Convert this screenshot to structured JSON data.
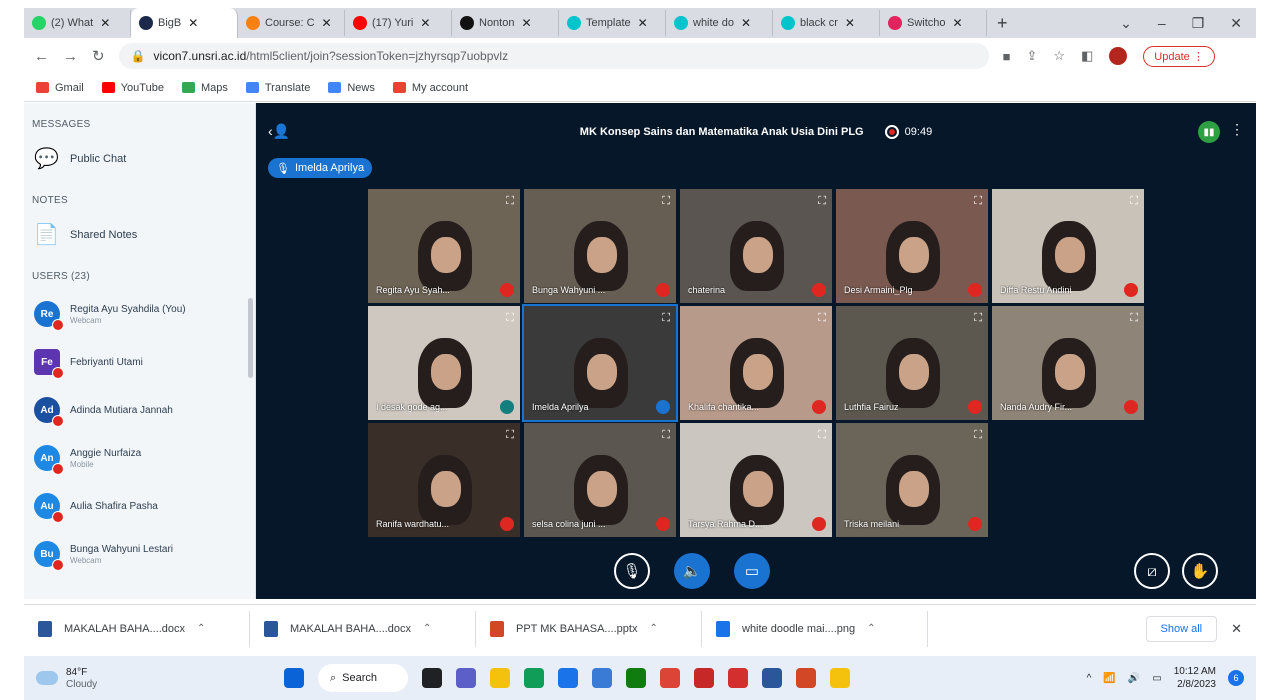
{
  "browser": {
    "tabs": [
      {
        "title": "(2) What",
        "icon": "whatsapp-icon",
        "color": "#25d366",
        "active": false
      },
      {
        "title": "BigB",
        "icon": "bigbluebutton-icon",
        "color": "#1b2a4a",
        "active": true
      },
      {
        "title": "Course: C",
        "icon": "moodle-icon",
        "color": "#f98012",
        "active": false
      },
      {
        "title": "(17) Yuri",
        "icon": "youtube-icon",
        "color": "#ff0000",
        "active": false
      },
      {
        "title": "Nonton",
        "icon": "video-icon",
        "color": "#111111",
        "active": false
      },
      {
        "title": "Template",
        "icon": "canva-icon",
        "color": "#00c4cc",
        "active": false
      },
      {
        "title": "white do",
        "icon": "canva-icon",
        "color": "#00c4cc",
        "active": false
      },
      {
        "title": "black cr",
        "icon": "canva-icon",
        "color": "#00c4cc",
        "active": false
      },
      {
        "title": "Switcho",
        "icon": "app-icon",
        "color": "#e0245e",
        "active": false
      }
    ],
    "url_host": "vicon7.unsri.ac.id",
    "url_path": "/html5client/join?sessionToken=jzhyrsqp7uobpvlz",
    "update_label": "Update",
    "bookmarks": [
      {
        "label": "Gmail",
        "color": "#ea4335"
      },
      {
        "label": "YouTube",
        "color": "#ff0000"
      },
      {
        "label": "Maps",
        "color": "#34a853"
      },
      {
        "label": "Translate",
        "color": "#4285f4"
      },
      {
        "label": "News",
        "color": "#4285f4"
      },
      {
        "label": "My account",
        "color": "#ea4335"
      }
    ]
  },
  "sidebar": {
    "messages_heading": "MESSAGES",
    "public_chat_label": "Public Chat",
    "notes_heading": "NOTES",
    "shared_notes_label": "Shared Notes",
    "users_heading": "USERS (23)",
    "users": [
      {
        "initials": "Re",
        "name": "Regita Ayu Syahdila (You)",
        "sub": "Webcam",
        "color": "#1b73d1",
        "square": false
      },
      {
        "initials": "Fe",
        "name": "Febriyanti Utami",
        "sub": "",
        "color": "#5e35b1",
        "square": true
      },
      {
        "initials": "Ad",
        "name": "Adinda Mutiara Jannah",
        "sub": "",
        "color": "#1b4fa0",
        "square": false
      },
      {
        "initials": "An",
        "name": "Anggie Nurfaiza",
        "sub": "Mobile",
        "color": "#1e88e5",
        "square": false
      },
      {
        "initials": "Au",
        "name": "Aulia Shafira Pasha",
        "sub": "",
        "color": "#1e88e5",
        "square": false
      },
      {
        "initials": "Bu",
        "name": "Bunga Wahyuni Lestari",
        "sub": "Webcam",
        "color": "#1e88e5",
        "square": false
      }
    ]
  },
  "meeting": {
    "title": "MK Konsep Sains dan Matematika Anak Usia Dini PLG",
    "rec_time": "09:49",
    "talking": "Imelda Aprilya",
    "tiles": [
      {
        "name": "Regita Ayu Syah...",
        "mic": "muted",
        "bg": "#6e6456"
      },
      {
        "name": "Bunga Wahyuni ...",
        "mic": "muted",
        "bg": "#665e52"
      },
      {
        "name": "chaterina",
        "mic": "muted",
        "bg": "#5a5550"
      },
      {
        "name": "Desi Armaini_Plg",
        "mic": "muted",
        "bg": "#7a5a50"
      },
      {
        "name": "Diffa Restu Andini",
        "mic": "muted",
        "bg": "#c9c2b8"
      },
      {
        "name": "I desak gode ag...",
        "mic": "teal",
        "bg": "#cfc8c0"
      },
      {
        "name": "Imelda Aprilya",
        "mic": "talking",
        "bg": "#3b3a3a"
      },
      {
        "name": "Khalifa chantika...",
        "mic": "muted",
        "bg": "#b89a8a"
      },
      {
        "name": "Luthfia Fairuz",
        "mic": "muted",
        "bg": "#5c584f"
      },
      {
        "name": "Nanda Audry Fir...",
        "mic": "muted",
        "bg": "#8e8478"
      },
      {
        "name": "Ranifa wardhatu...",
        "mic": "muted",
        "bg": "#3a2e28"
      },
      {
        "name": "selsa colina juni ...",
        "mic": "muted",
        "bg": "#5b5650"
      },
      {
        "name": "Tarsya Rahma D...",
        "mic": "muted",
        "bg": "#cbc6c0"
      },
      {
        "name": "Triska meilani",
        "mic": "muted",
        "bg": "#6b6459"
      }
    ]
  },
  "downloads": {
    "items": [
      {
        "name": "MAKALAH BAHA....docx",
        "color": "#2b579a"
      },
      {
        "name": "MAKALAH BAHA....docx",
        "color": "#2b579a"
      },
      {
        "name": "PPT MK BAHASA....pptx",
        "color": "#d24726"
      },
      {
        "name": "white doodle mai....png",
        "color": "#1a73e8"
      }
    ],
    "show_all": "Show all"
  },
  "taskbar": {
    "temp": "84°F",
    "condition": "Cloudy",
    "search_label": "Search",
    "time": "10:12 AM",
    "date": "2/8/2023",
    "notifications": "6",
    "apps": [
      {
        "icon": "start-icon",
        "color": "#0a64d8"
      },
      {
        "icon": "task-view-icon",
        "color": "#202124"
      },
      {
        "icon": "meet-icon",
        "color": "#5b5fc7"
      },
      {
        "icon": "file-explorer-icon",
        "color": "#f4c20d"
      },
      {
        "icon": "edge-icon",
        "color": "#0f9d58"
      },
      {
        "icon": "store-icon",
        "color": "#1a73e8"
      },
      {
        "icon": "app-icon",
        "color": "#3a7bd5"
      },
      {
        "icon": "xbox-icon",
        "color": "#107c10"
      },
      {
        "icon": "chrome-icon",
        "color": "#db4437"
      },
      {
        "icon": "wps-icon",
        "color": "#c62828"
      },
      {
        "icon": "app-icon",
        "color": "#d32f2f"
      },
      {
        "icon": "word-icon",
        "color": "#2b579a"
      },
      {
        "icon": "powerpoint-icon",
        "color": "#d24726"
      },
      {
        "icon": "app-icon",
        "color": "#f4c20d"
      }
    ]
  }
}
